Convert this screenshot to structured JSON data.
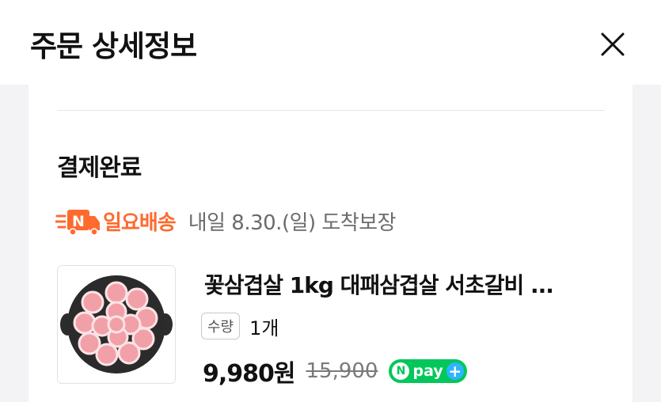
{
  "header": {
    "title": "주문 상세정보",
    "close_icon": "close-icon"
  },
  "order": {
    "status": "결제완료",
    "delivery": {
      "icon": "truck-n-icon",
      "label": "일요배송",
      "date": "내일 8.30.(일) 도착보장"
    },
    "product": {
      "image_icon": "pork-belly-product-image",
      "name": "꽃삼겹살 1kg 대패삼겹살 서초갈비 ...",
      "quantity_label": "수량",
      "quantity_value": "1개",
      "price": "9,980원",
      "original_price": "15,900",
      "npay": {
        "n": "N",
        "label": "pay",
        "plus": "+"
      }
    }
  },
  "colors": {
    "accent_orange": "#ff6a2f",
    "npay_green": "#03c75a",
    "npay_plus_blue": "#2db5ff"
  }
}
